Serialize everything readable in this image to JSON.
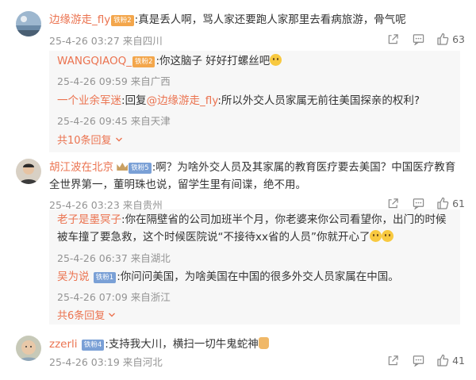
{
  "comments": [
    {
      "user": "边缘游走_fly",
      "badge": "铁粉2",
      "text": "真是丢人啊，骂人家还要跑人家那里去看病旅游，骨气呢",
      "time": "25-4-26 03:27",
      "location": "来自四川",
      "likes": "63"
    },
    {
      "user": "胡江波在北京",
      "badge": "铁粉5",
      "text": "啊？为啥外交人员及其家属的教育医疗要去美国？中国医疗教育全世界第一，董明珠也说，留学生里有间谍，绝不用。",
      "time": "25-4-26 03:23",
      "location": "来自贵州",
      "likes": "61"
    },
    {
      "user": "zzerli",
      "badge": "铁粉4",
      "text": "支持我大川，横扫一切牛鬼蛇神",
      "time": "25-4-26 03:19",
      "location": "来自河北",
      "likes": "41"
    }
  ],
  "replies1": [
    {
      "user": "WANGQIAOQ_",
      "badge": "铁粉2",
      "text": "你这脑子  好好打螺丝吧",
      "time": "25-4-26 09:59",
      "location": "来自广西"
    },
    {
      "user": "一个业余军迷",
      "reply_prefix": "回复",
      "reply_to": "@边缘游走_fly",
      "text": "所以外交人员家属无前往美国探亲的权利?",
      "time": "25-4-26 09:45",
      "location": "来自天津"
    }
  ],
  "replies1_more": "共10条回复",
  "replies2": [
    {
      "user": "老子是墨冥子",
      "text": "你在隔壁省的公司加班半个月，你老婆来你公司看望你，出门的时候被车撞了要急救，这个时候医院说“不接待xx省的人员”你就开心了",
      "time": "25-4-26 06:37",
      "location": "来自湖北"
    },
    {
      "user": "吴为说",
      "badge": "铁粉1",
      "text": "你问问美国，为啥美国在中国的很多外交人员家属在中国。",
      "time": "25-4-26 07:09",
      "location": "来自浙江"
    }
  ],
  "replies2_more": "共6条回复",
  "colors": {
    "username": "#eb7350",
    "meta": "#939393",
    "reply_bg": "#f7f7f7"
  },
  "icons": [
    "share-icon",
    "comment-icon",
    "like-icon",
    "chevron-down-icon"
  ]
}
